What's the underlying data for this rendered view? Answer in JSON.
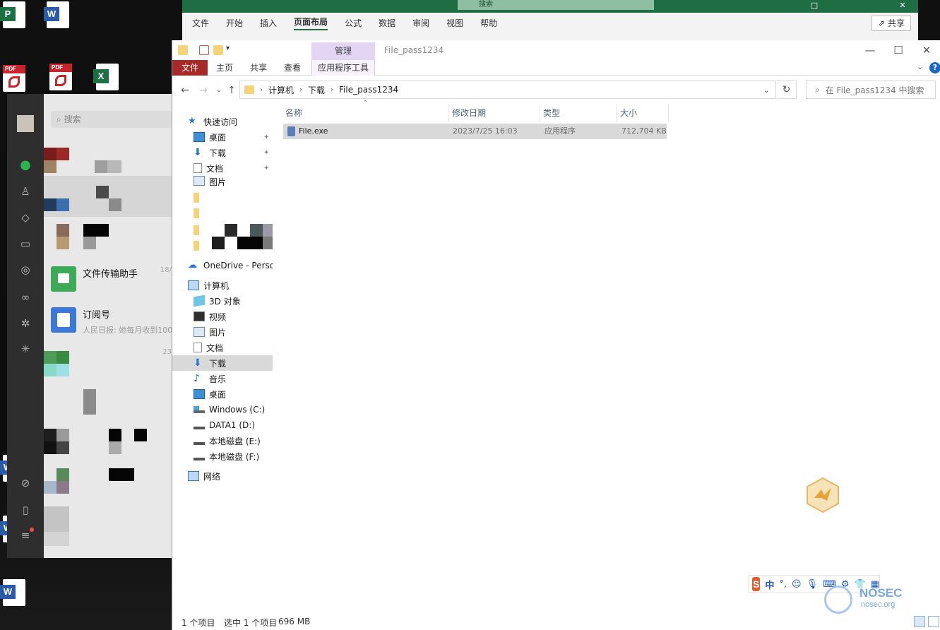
{
  "excel": {
    "search_label": "搜索",
    "menu": [
      "文件",
      "开始",
      "插入",
      "页面布局",
      "公式",
      "数据",
      "审阅",
      "视图",
      "帮助"
    ],
    "active_menu": "页面布局",
    "share_label": "共享"
  },
  "wechat": {
    "search_placeholder": "搜索",
    "items": [
      {
        "name": "文件传输助手",
        "time": "18/",
        "message": ""
      },
      {
        "name": "订阅号",
        "time": "",
        "message": "人民日报: 她每月收到1000"
      }
    ],
    "other_time": "23"
  },
  "explorer": {
    "title": "File_pass1234",
    "context_tab_group": "管理",
    "ribbon_tabs": [
      "文件",
      "主页",
      "共享",
      "查看",
      "应用程序工具"
    ],
    "breadcrumbs": [
      "计算机",
      "下载",
      "File_pass1234"
    ],
    "search_placeholder": "在 File_pass1234 中搜索",
    "nav": {
      "quick_access": "快速访问",
      "quick_items": [
        "桌面",
        "下载",
        "文档",
        "图片"
      ],
      "onedrive": "OneDrive - Persona",
      "computer": "计算机",
      "computer_items": [
        "3D 对象",
        "视频",
        "图片",
        "文档",
        "下载",
        "音乐",
        "桌面",
        "Windows (C:)",
        "DATA1 (D:)",
        "本地磁盘 (E:)",
        "本地磁盘 (F:)"
      ],
      "network": "网络",
      "selected": "下载"
    },
    "columns": [
      "名称",
      "修改日期",
      "类型",
      "大小"
    ],
    "files": [
      {
        "name": "File.exe",
        "modified": "2023/7/25 16:03",
        "type": "应用程序",
        "size": "712,704 KB"
      }
    ],
    "status": {
      "count": "1 个项目",
      "selection": "选中 1 个项目",
      "size": "696 MB"
    }
  },
  "ime": {
    "label": "中"
  },
  "watermark": {
    "brand": "NOSEC",
    "url": "nosec.org"
  },
  "colors": {
    "file_tab": "#a52a28",
    "context_tab": "#e5d5f5",
    "excel_green": "#1f6e43",
    "selection": "#d9d9d9"
  }
}
